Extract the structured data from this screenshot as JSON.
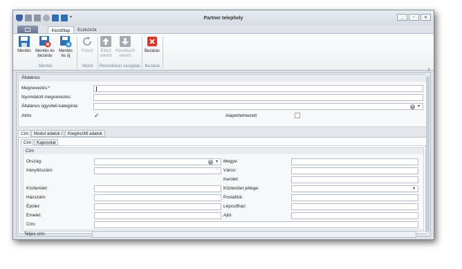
{
  "window": {
    "title": "Partner telephely",
    "controls": [
      "_",
      "▫",
      "✕"
    ]
  },
  "ribbon": {
    "tabs": [
      "Kezdőlap",
      "Eszközök"
    ],
    "buttons": {
      "save": "Mentés",
      "save_close_1": "Mentés és",
      "save_close_2": "bezárás",
      "save_new_1": "Mentés",
      "save_new_2": "és új",
      "refresh": "Frissít",
      "prev_1": "Előző",
      "prev_2": "rekord",
      "next_1": "Következő",
      "next_2": "rekord",
      "close": "Bezárás"
    },
    "groups": [
      "Mentés",
      "Nézet",
      "Rekordokon navigálás",
      "Bezárás"
    ]
  },
  "general": {
    "header": "Általános",
    "name_label": "Megnevezés:*",
    "name_value": "",
    "printed_name_label": "Nyomtatott megnevezés:",
    "printed_name_value": "",
    "category_label": "Általános ügyviteli kategória:",
    "category_value": "",
    "active_label": "Aktív",
    "active_checked": true,
    "default_label": "Alapértelmezett",
    "default_checked": false
  },
  "tabs": [
    "Cím",
    "Modul adatok I",
    "Kiegészítő adatok"
  ],
  "subtabs": [
    "Cím",
    "Kapcsolat"
  ],
  "address": {
    "header": "Cím",
    "country": "Ország:",
    "zip": "Irányítószám:",
    "county": "Megye:",
    "city": "Város:",
    "district": "Kerület:",
    "public_area": "Közterület:",
    "public_area_type": "Közterület jellege:",
    "house_number": "Házszám:",
    "po_box": "Postafiók:",
    "building": "Épület:",
    "staircase": "Lépcsőház:",
    "floor": "Emelet:",
    "door": "Ajtó:",
    "address": "Cím:",
    "full_address": "Teljes cím:"
  },
  "icons": {
    "zip_more": "···",
    "clear": "✕",
    "dropdown": "▾",
    "collapse": "⇧"
  }
}
